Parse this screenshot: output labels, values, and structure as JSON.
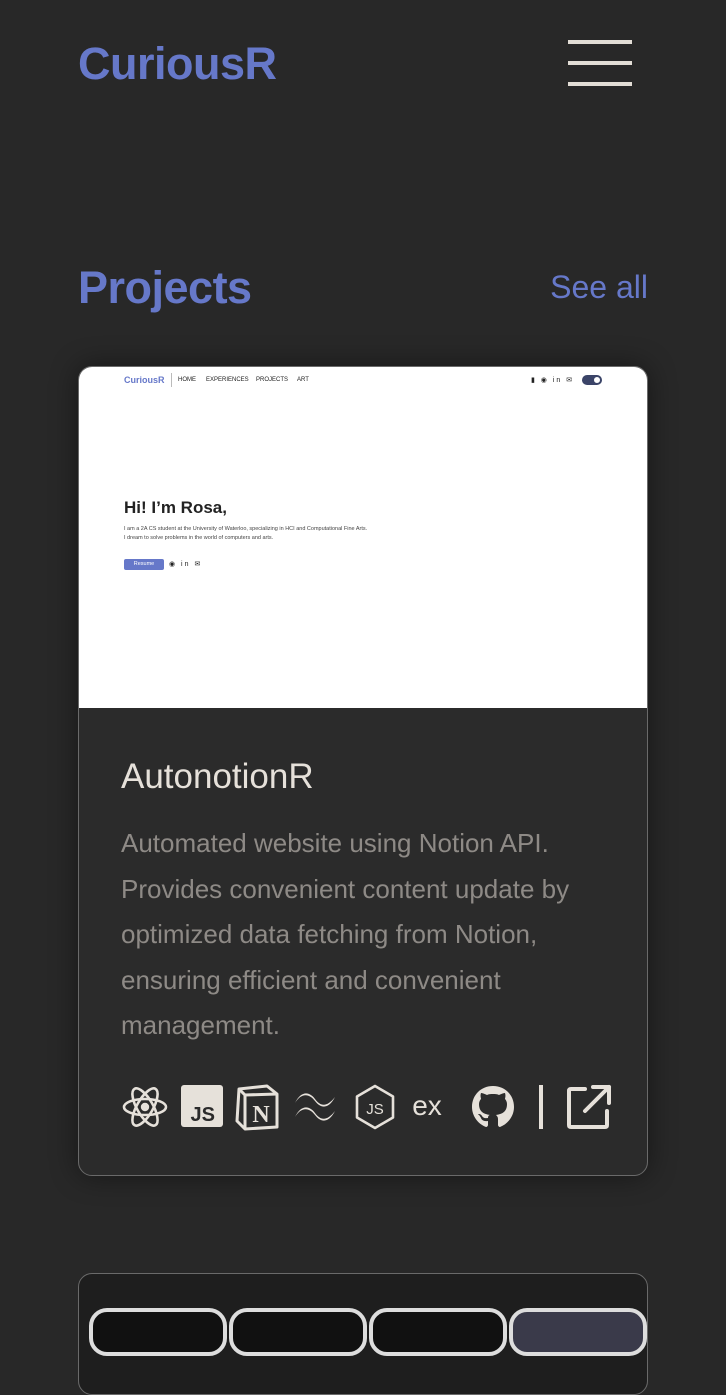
{
  "header": {
    "logo": "CuriousR"
  },
  "projects": {
    "title": "Projects",
    "see_all": "See all"
  },
  "card": {
    "preview": {
      "logo": "CuriousR",
      "nav": [
        "HOME",
        "EXPERIENCES",
        "PROJECTS",
        "ART"
      ],
      "greeting": "Hi! I’m Rosa,",
      "desc_line1": "I am a 2A CS student at the University of Waterloo, specializing in HCI and Computational Fine Arts.",
      "desc_line2": "I dream to solve problems in the world of computers and arts.",
      "resume_label": "Resume"
    },
    "title": "AutonotionR",
    "description": "Automated website using Notion API. Provides convenient content update by optimized data fetching from Notion, ensuring efficient and convenient management.",
    "tech_icons": [
      "react-icon",
      "javascript-icon",
      "notion-icon",
      "tailwind-icon",
      "nodejs-icon",
      "express-icon"
    ],
    "link_icons": [
      "github-icon",
      "external-link-icon"
    ],
    "express_text": "ex",
    "js_text": "JS",
    "notion_text": "N"
  },
  "colors": {
    "accent": "#6678c9",
    "background": "#282828",
    "card_bg": "#2b2b2b",
    "title_text": "#e6e1da",
    "body_text": "#8e8a86"
  }
}
